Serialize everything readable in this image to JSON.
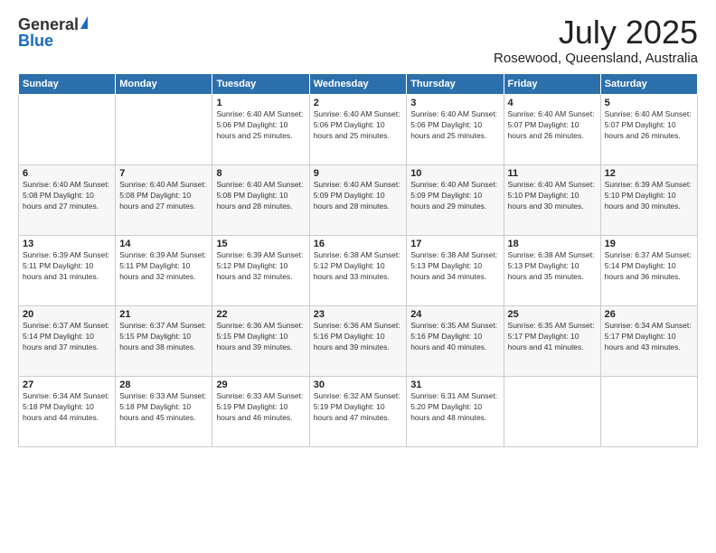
{
  "logo": {
    "general": "General",
    "blue": "Blue"
  },
  "title": {
    "month_year": "July 2025",
    "location": "Rosewood, Queensland, Australia"
  },
  "weekdays": [
    "Sunday",
    "Monday",
    "Tuesday",
    "Wednesday",
    "Thursday",
    "Friday",
    "Saturday"
  ],
  "weeks": [
    [
      {
        "day": "",
        "info": ""
      },
      {
        "day": "",
        "info": ""
      },
      {
        "day": "1",
        "info": "Sunrise: 6:40 AM\nSunset: 5:06 PM\nDaylight: 10 hours\nand 25 minutes."
      },
      {
        "day": "2",
        "info": "Sunrise: 6:40 AM\nSunset: 5:06 PM\nDaylight: 10 hours\nand 25 minutes."
      },
      {
        "day": "3",
        "info": "Sunrise: 6:40 AM\nSunset: 5:06 PM\nDaylight: 10 hours\nand 25 minutes."
      },
      {
        "day": "4",
        "info": "Sunrise: 6:40 AM\nSunset: 5:07 PM\nDaylight: 10 hours\nand 26 minutes."
      },
      {
        "day": "5",
        "info": "Sunrise: 6:40 AM\nSunset: 5:07 PM\nDaylight: 10 hours\nand 26 minutes."
      }
    ],
    [
      {
        "day": "6",
        "info": "Sunrise: 6:40 AM\nSunset: 5:08 PM\nDaylight: 10 hours\nand 27 minutes."
      },
      {
        "day": "7",
        "info": "Sunrise: 6:40 AM\nSunset: 5:08 PM\nDaylight: 10 hours\nand 27 minutes."
      },
      {
        "day": "8",
        "info": "Sunrise: 6:40 AM\nSunset: 5:08 PM\nDaylight: 10 hours\nand 28 minutes."
      },
      {
        "day": "9",
        "info": "Sunrise: 6:40 AM\nSunset: 5:09 PM\nDaylight: 10 hours\nand 28 minutes."
      },
      {
        "day": "10",
        "info": "Sunrise: 6:40 AM\nSunset: 5:09 PM\nDaylight: 10 hours\nand 29 minutes."
      },
      {
        "day": "11",
        "info": "Sunrise: 6:40 AM\nSunset: 5:10 PM\nDaylight: 10 hours\nand 30 minutes."
      },
      {
        "day": "12",
        "info": "Sunrise: 6:39 AM\nSunset: 5:10 PM\nDaylight: 10 hours\nand 30 minutes."
      }
    ],
    [
      {
        "day": "13",
        "info": "Sunrise: 6:39 AM\nSunset: 5:11 PM\nDaylight: 10 hours\nand 31 minutes."
      },
      {
        "day": "14",
        "info": "Sunrise: 6:39 AM\nSunset: 5:11 PM\nDaylight: 10 hours\nand 32 minutes."
      },
      {
        "day": "15",
        "info": "Sunrise: 6:39 AM\nSunset: 5:12 PM\nDaylight: 10 hours\nand 32 minutes."
      },
      {
        "day": "16",
        "info": "Sunrise: 6:38 AM\nSunset: 5:12 PM\nDaylight: 10 hours\nand 33 minutes."
      },
      {
        "day": "17",
        "info": "Sunrise: 6:38 AM\nSunset: 5:13 PM\nDaylight: 10 hours\nand 34 minutes."
      },
      {
        "day": "18",
        "info": "Sunrise: 6:38 AM\nSunset: 5:13 PM\nDaylight: 10 hours\nand 35 minutes."
      },
      {
        "day": "19",
        "info": "Sunrise: 6:37 AM\nSunset: 5:14 PM\nDaylight: 10 hours\nand 36 minutes."
      }
    ],
    [
      {
        "day": "20",
        "info": "Sunrise: 6:37 AM\nSunset: 5:14 PM\nDaylight: 10 hours\nand 37 minutes."
      },
      {
        "day": "21",
        "info": "Sunrise: 6:37 AM\nSunset: 5:15 PM\nDaylight: 10 hours\nand 38 minutes."
      },
      {
        "day": "22",
        "info": "Sunrise: 6:36 AM\nSunset: 5:15 PM\nDaylight: 10 hours\nand 39 minutes."
      },
      {
        "day": "23",
        "info": "Sunrise: 6:36 AM\nSunset: 5:16 PM\nDaylight: 10 hours\nand 39 minutes."
      },
      {
        "day": "24",
        "info": "Sunrise: 6:35 AM\nSunset: 5:16 PM\nDaylight: 10 hours\nand 40 minutes."
      },
      {
        "day": "25",
        "info": "Sunrise: 6:35 AM\nSunset: 5:17 PM\nDaylight: 10 hours\nand 41 minutes."
      },
      {
        "day": "26",
        "info": "Sunrise: 6:34 AM\nSunset: 5:17 PM\nDaylight: 10 hours\nand 43 minutes."
      }
    ],
    [
      {
        "day": "27",
        "info": "Sunrise: 6:34 AM\nSunset: 5:18 PM\nDaylight: 10 hours\nand 44 minutes."
      },
      {
        "day": "28",
        "info": "Sunrise: 6:33 AM\nSunset: 5:18 PM\nDaylight: 10 hours\nand 45 minutes."
      },
      {
        "day": "29",
        "info": "Sunrise: 6:33 AM\nSunset: 5:19 PM\nDaylight: 10 hours\nand 46 minutes."
      },
      {
        "day": "30",
        "info": "Sunrise: 6:32 AM\nSunset: 5:19 PM\nDaylight: 10 hours\nand 47 minutes."
      },
      {
        "day": "31",
        "info": "Sunrise: 6:31 AM\nSunset: 5:20 PM\nDaylight: 10 hours\nand 48 minutes."
      },
      {
        "day": "",
        "info": ""
      },
      {
        "day": "",
        "info": ""
      }
    ]
  ]
}
